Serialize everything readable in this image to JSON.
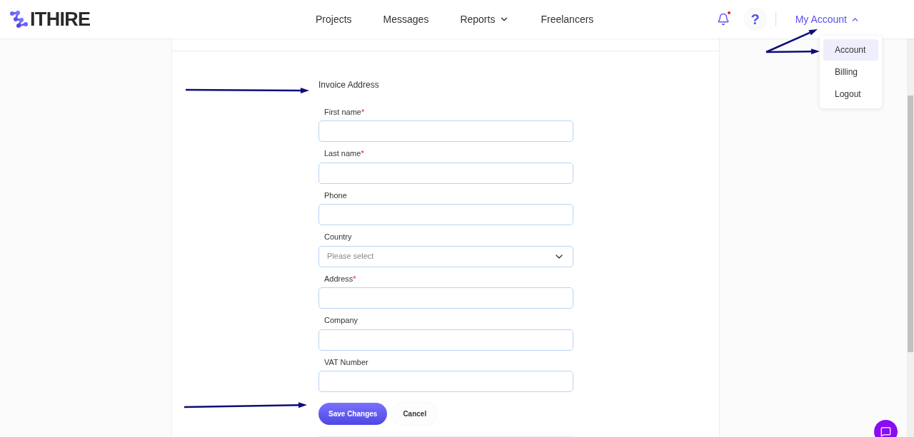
{
  "header": {
    "logo": "ITHIRE",
    "nav": [
      {
        "label": "Projects",
        "kind": "link"
      },
      {
        "label": "Messages",
        "kind": "link"
      },
      {
        "label": "Reports",
        "kind": "dropdown"
      },
      {
        "label": "Freelancers",
        "kind": "link"
      }
    ],
    "notifications": {
      "unread": true
    },
    "help": "?",
    "account": {
      "label": "My Account",
      "expanded": true,
      "menu": [
        {
          "label": "Account",
          "selected": true
        },
        {
          "label": "Billing",
          "selected": false
        },
        {
          "label": "Logout",
          "selected": false
        }
      ]
    }
  },
  "form": {
    "title": "Invoice Address",
    "fields": [
      {
        "label": "First name",
        "required_mark": "*",
        "kind": "text"
      },
      {
        "label": "Last name",
        "required_mark": "*",
        "kind": "text"
      },
      {
        "label": "Phone",
        "kind": "text"
      },
      {
        "label": "Country",
        "kind": "select",
        "placeholder": "Please select"
      },
      {
        "label": "Address",
        "required_mark": "*",
        "kind": "text"
      },
      {
        "label": "Company",
        "kind": "text"
      },
      {
        "label": "VAT Number",
        "kind": "text"
      }
    ],
    "buttons": [
      {
        "label": "Save Changes",
        "kind": "primary"
      },
      {
        "label": "Cancel",
        "kind": "secondary"
      }
    ]
  }
}
